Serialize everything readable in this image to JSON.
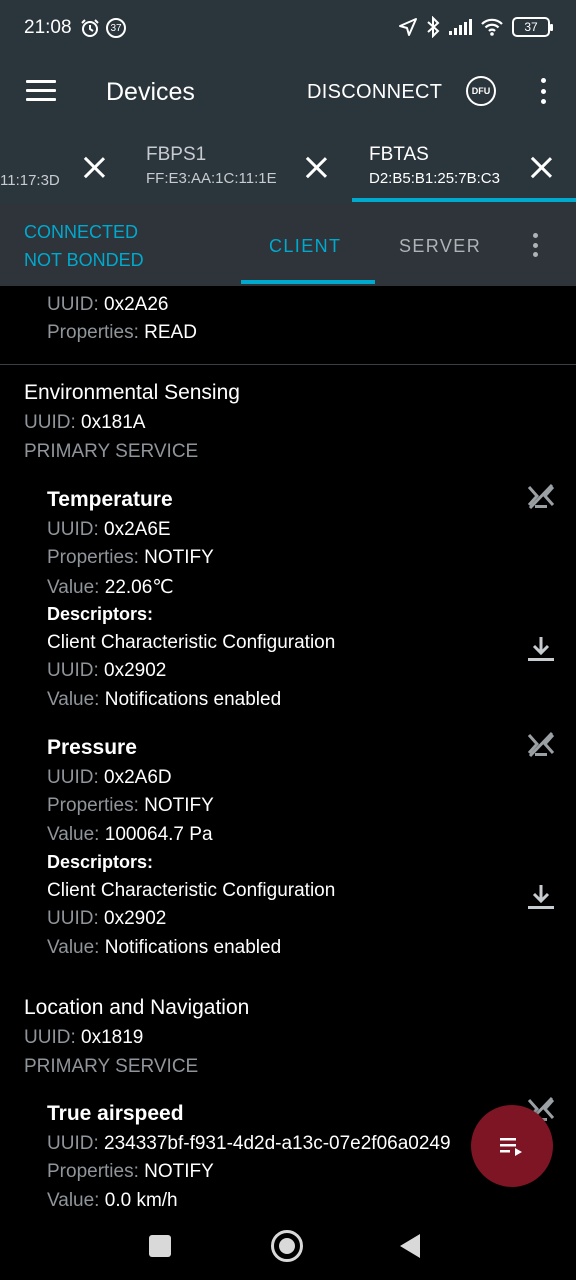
{
  "status_bar": {
    "time": "21:08",
    "notification_count": "37",
    "battery": "37",
    "icons": [
      "alarm-icon",
      "notification-badge-icon",
      "location-icon",
      "bluetooth-icon",
      "signal-icon",
      "wifi-icon",
      "battery-icon"
    ]
  },
  "app_bar": {
    "title": "Devices",
    "disconnect_label": "DISCONNECT",
    "dfu_label": "DFU"
  },
  "device_tabs": [
    {
      "name": "",
      "address": "11:17:3D",
      "active": false
    },
    {
      "name": "FBPS1",
      "address": "FF:E3:AA:1C:11:1E",
      "active": false
    },
    {
      "name": "FBTAS",
      "address": "D2:B5:B1:25:7B:C3",
      "active": true
    }
  ],
  "connection": {
    "state": "CONNECTED",
    "bond": "NOT BONDED"
  },
  "sub_tabs": {
    "client": "CLIENT",
    "server": "SERVER",
    "active": "CLIENT"
  },
  "labels": {
    "uuid": "UUID:",
    "properties": "Properties:",
    "value": "Value:",
    "descriptors": "Descriptors:",
    "primary_service": "PRIMARY SERVICE"
  },
  "partial_char": {
    "uuid": "0x2A26",
    "properties": "READ"
  },
  "services": [
    {
      "name": "Environmental Sensing",
      "uuid": "0x181A",
      "characteristics": [
        {
          "name": "Temperature",
          "uuid": "0x2A6E",
          "properties": "NOTIFY",
          "value": "22.06℃",
          "descriptor": {
            "name": "Client Characteristic Configuration",
            "uuid": "0x2902",
            "value": "Notifications enabled"
          }
        },
        {
          "name": "Pressure",
          "uuid": "0x2A6D",
          "properties": "NOTIFY",
          "value": "100064.7 Pa",
          "descriptor": {
            "name": "Client Characteristic Configuration",
            "uuid": "0x2902",
            "value": "Notifications enabled"
          }
        }
      ]
    },
    {
      "name": "Location and Navigation",
      "uuid": "0x1819",
      "characteristics": [
        {
          "name": "True airspeed",
          "uuid": "234337bf-f931-4d2d-a13c-07e2f06a0249",
          "properties": "NOTIFY",
          "value": "0.0 km/h"
        }
      ]
    }
  ],
  "colors": {
    "accent": "#00a9ce",
    "app_bar": "#2b353c",
    "fab": "#7d1524",
    "secondary_text": "#8f959a"
  }
}
